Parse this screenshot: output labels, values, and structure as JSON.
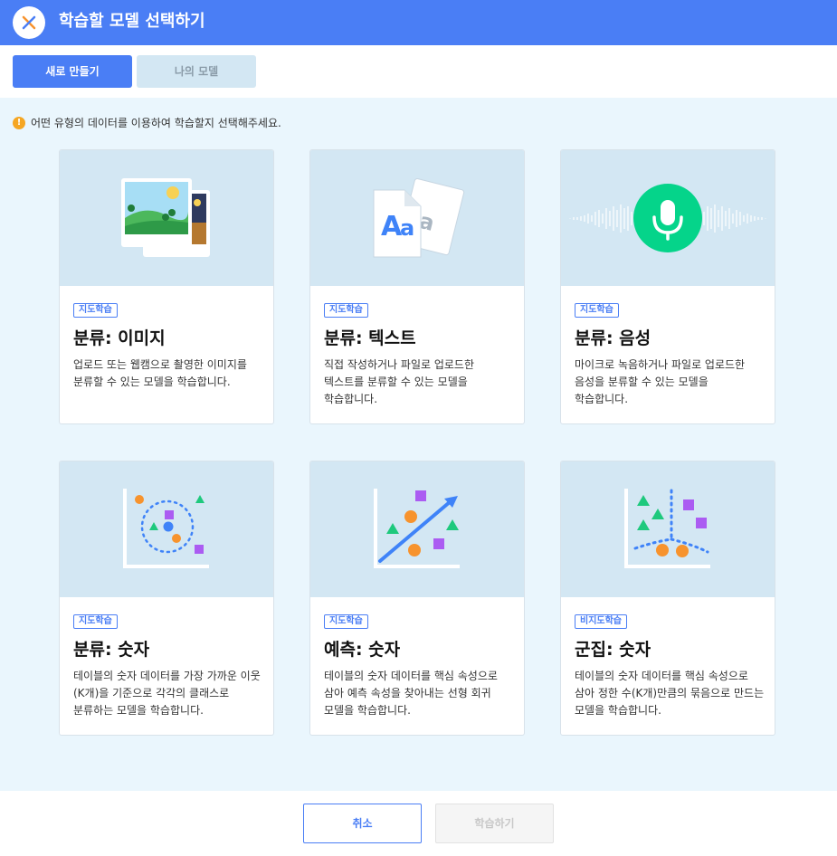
{
  "header": {
    "title": "학습할 모델 선택하기",
    "logo_icon": "close-x-logo-icon",
    "bg_color": "#4a7ef5"
  },
  "tabs": [
    {
      "label": "새로 만들기",
      "active": true
    },
    {
      "label": "나의 모델",
      "active": false
    }
  ],
  "notice": {
    "icon": "warning-icon",
    "text": "어떤 유형의 데이터를 이용하여 학습할지 선택해주세요."
  },
  "cards": [
    {
      "badge": "지도학습",
      "title": "분류: 이미지",
      "description": "업로드 또는 웹캠으로 촬영한 이미지를 분류할 수 있는 모델을 학습합니다.",
      "icon": "image-photos-icon"
    },
    {
      "badge": "지도학습",
      "title": "분류: 텍스트",
      "description": "직접 작성하거나 파일로 업로드한 텍스트를 분류할 수 있는 모델을 학습합니다.",
      "icon": "text-document-icon"
    },
    {
      "badge": "지도학습",
      "title": "분류: 음성",
      "description": "마이크로 녹음하거나 파일로 업로드한 음성을 분류할 수 있는 모델을 학습합니다.",
      "icon": "microphone-icon"
    },
    {
      "badge": "지도학습",
      "title": "분류: 숫자",
      "description": "테이블의 숫자 데이터를 가장 가까운 이웃(K개)을 기준으로 각각의 클래스로 분류하는 모델을 학습합니다.",
      "icon": "knn-scatter-icon"
    },
    {
      "badge": "지도학습",
      "title": "예측: 숫자",
      "description": "테이블의 숫자 데이터를 핵심 속성으로 삼아 예측 속성을 찾아내는 선형 회귀 모델을 학습합니다.",
      "icon": "regression-scatter-icon"
    },
    {
      "badge": "비지도학습",
      "title": "군집: 숫자",
      "description": "테이블의 숫자 데이터를 핵심 속성으로 삼아 정한 수(K개)만큼의 묶음으로 만드는 모델을 학습합니다.",
      "icon": "cluster-scatter-icon"
    }
  ],
  "footer": {
    "cancel_label": "취소",
    "learn_label": "학습하기"
  },
  "colors": {
    "accent": "#4a7ef5",
    "panel_bg": "#eaf6fd",
    "card_image_bg": "#d3e7f3",
    "mic_green": "#05d48a",
    "orange": "#f7932d",
    "purple": "#ab5cf2",
    "green_shape": "#1ec97d"
  }
}
